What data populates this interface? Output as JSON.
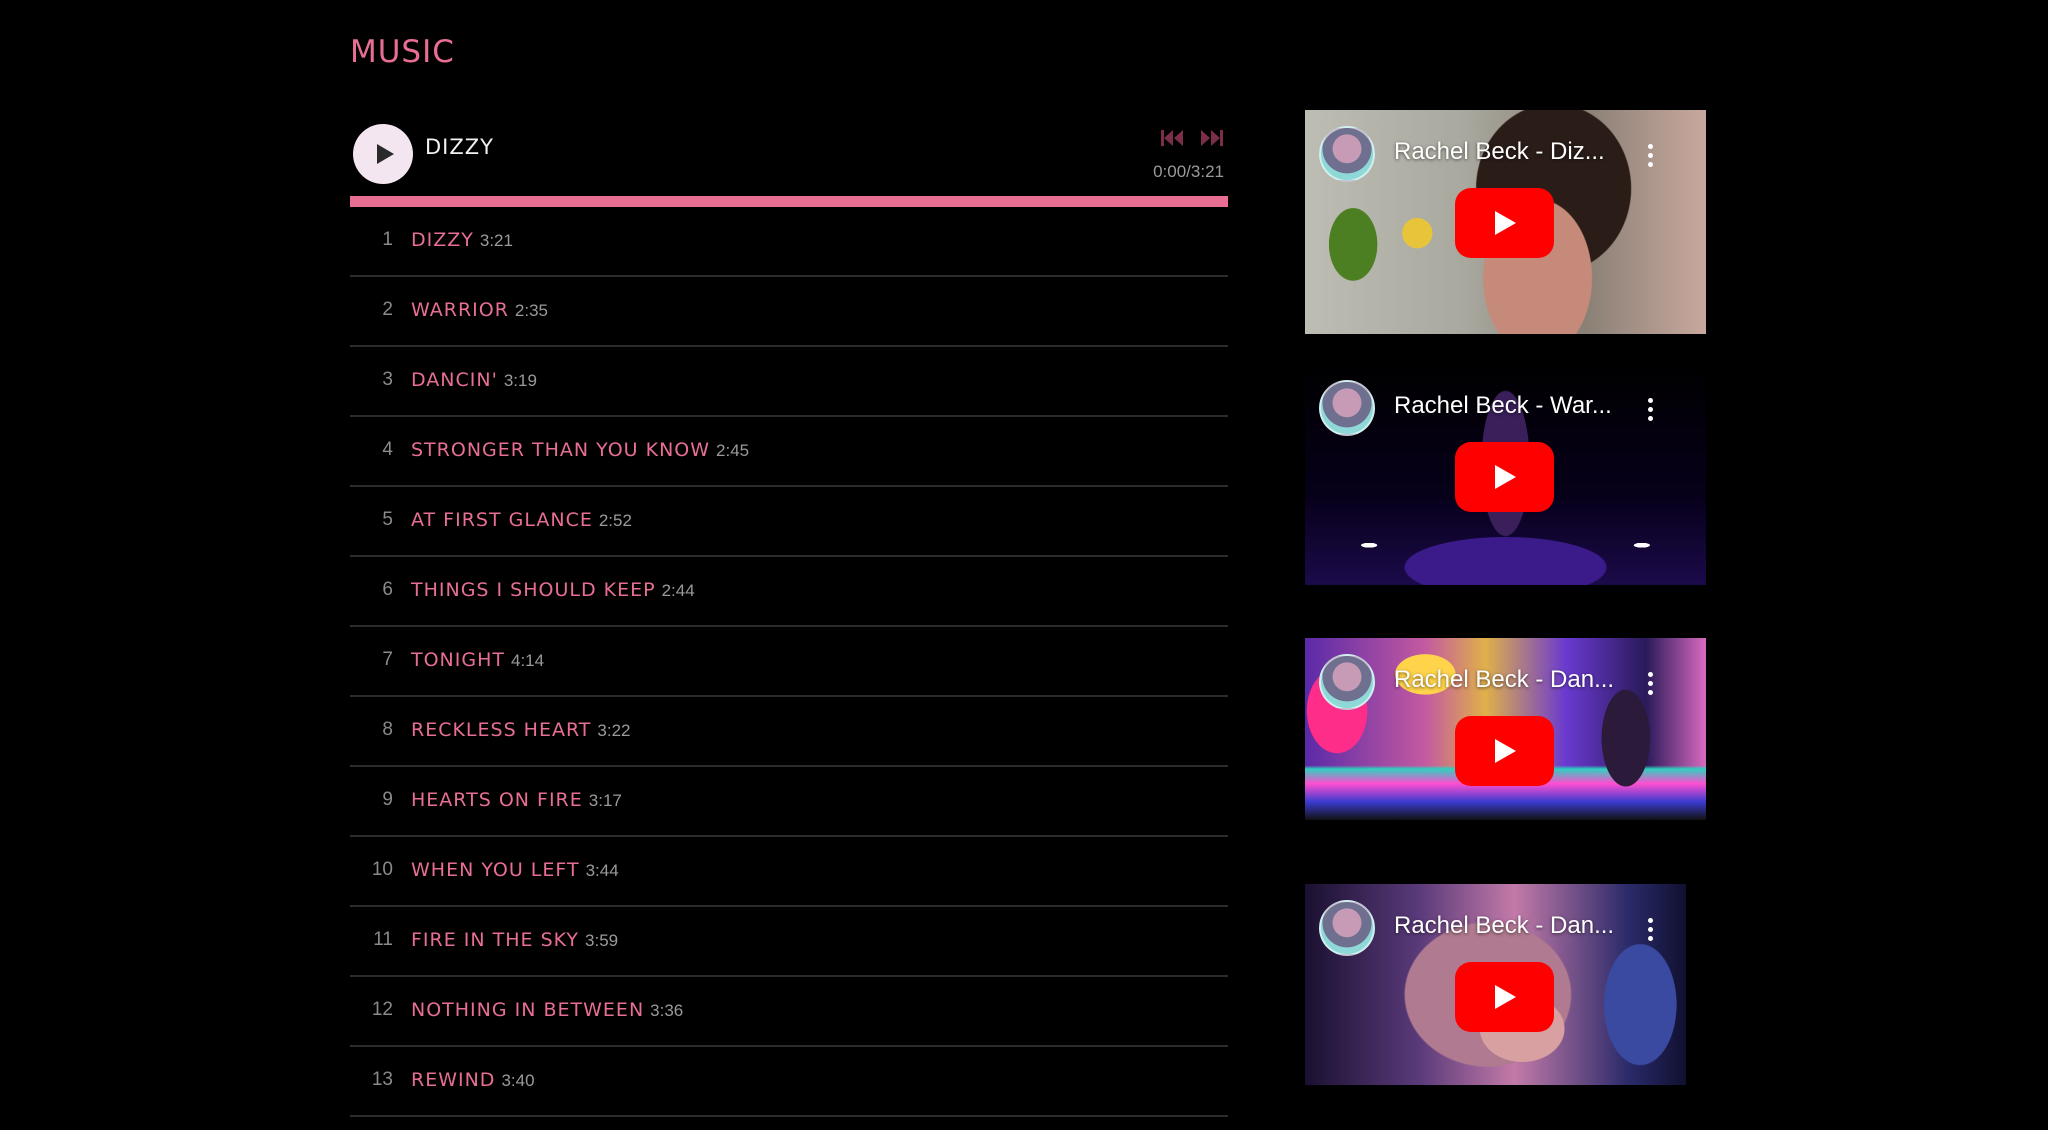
{
  "theme": {
    "accent": "#e86f93",
    "background": "#000000"
  },
  "section": {
    "title": "MUSIC"
  },
  "player": {
    "now_playing": "DIZZY",
    "time": "0:00/3:21",
    "progress_fraction": 1.0,
    "icons": {
      "play": "play-icon",
      "prev": "skip-previous-icon",
      "next": "skip-next-icon"
    }
  },
  "tracks": [
    {
      "num": "1",
      "title": "DIZZY",
      "duration": "3:21"
    },
    {
      "num": "2",
      "title": "WARRIOR",
      "duration": "2:35"
    },
    {
      "num": "3",
      "title": "DANCIN'",
      "duration": "3:19"
    },
    {
      "num": "4",
      "title": "STRONGER THAN YOU KNOW",
      "duration": "2:45"
    },
    {
      "num": "5",
      "title": "AT FIRST GLANCE",
      "duration": "2:52"
    },
    {
      "num": "6",
      "title": "THINGS I SHOULD KEEP",
      "duration": "2:44"
    },
    {
      "num": "7",
      "title": "TONIGHT",
      "duration": "4:14"
    },
    {
      "num": "8",
      "title": "RECKLESS HEART",
      "duration": "3:22"
    },
    {
      "num": "9",
      "title": "HEARTS ON FIRE",
      "duration": "3:17"
    },
    {
      "num": "10",
      "title": "WHEN YOU LEFT",
      "duration": "3:44"
    },
    {
      "num": "11",
      "title": "FIRE IN THE SKY",
      "duration": "3:59"
    },
    {
      "num": "12",
      "title": "NOTHING IN BETWEEN",
      "duration": "3:36"
    },
    {
      "num": "13",
      "title": "REWIND",
      "duration": "3:40"
    }
  ],
  "videos": [
    {
      "title": "Rachel Beck - Diz...",
      "icons": {
        "avatar": "channel-avatar",
        "menu": "more-vert-icon",
        "play": "youtube-play-icon"
      }
    },
    {
      "title": "Rachel Beck - War...",
      "icons": {
        "avatar": "channel-avatar",
        "menu": "more-vert-icon",
        "play": "youtube-play-icon"
      }
    },
    {
      "title": "Rachel Beck - Dan...",
      "icons": {
        "avatar": "channel-avatar",
        "menu": "more-vert-icon",
        "play": "youtube-play-icon"
      }
    },
    {
      "title": "Rachel Beck - Dan...",
      "icons": {
        "avatar": "channel-avatar",
        "menu": "more-vert-icon",
        "play": "youtube-play-icon"
      }
    }
  ]
}
